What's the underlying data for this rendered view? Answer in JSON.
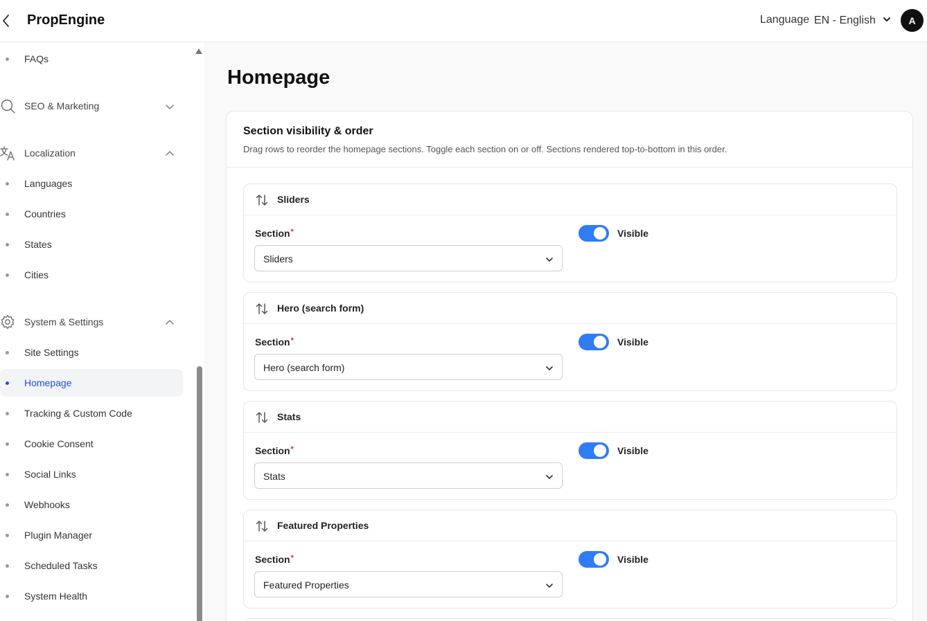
{
  "header": {
    "brand": "PropEngine",
    "language_label": "Language",
    "language_value": "EN - English",
    "avatar_initial": "A"
  },
  "sidebar": {
    "faqs": "FAQs",
    "seo_group": "SEO & Marketing",
    "localization_group": "Localization",
    "localization_items": [
      "Languages",
      "Countries",
      "States",
      "Cities"
    ],
    "system_group": "System & Settings",
    "system_items": [
      "Site Settings",
      "Homepage",
      "Tracking & Custom Code",
      "Cookie Consent",
      "Social Links",
      "Webhooks",
      "Plugin Manager",
      "Scheduled Tasks",
      "System Health"
    ],
    "active_item": "Homepage"
  },
  "main": {
    "title": "Homepage",
    "card": {
      "title": "Section visibility & order",
      "description": "Drag rows to reorder the homepage sections. Toggle each section on or off. Sections rendered top-to-bottom in this order."
    },
    "section_label": "Section",
    "required_mark": "*",
    "visible_label": "Visible",
    "rows": [
      {
        "title": "Sliders",
        "value": "Sliders",
        "visible": true
      },
      {
        "title": "Hero (search form)",
        "value": "Hero (search form)",
        "visible": true
      },
      {
        "title": "Stats",
        "value": "Stats",
        "visible": true
      },
      {
        "title": "Featured Properties",
        "value": "Featured Properties",
        "visible": true
      }
    ]
  },
  "colors": {
    "accent": "#2f7cf6",
    "active_link": "#1d4ed8",
    "required": "#e11d48"
  }
}
